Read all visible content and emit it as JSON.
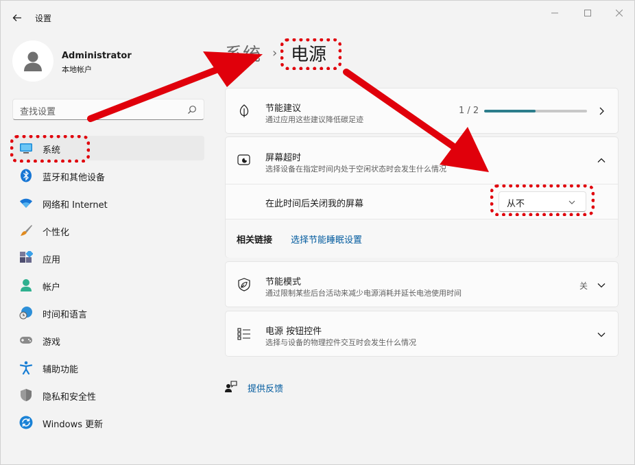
{
  "window": {
    "app_title": "设置"
  },
  "user": {
    "name": "Administrator",
    "subtitle": "本地帐户"
  },
  "search": {
    "placeholder": "查找设置"
  },
  "sidebar": {
    "items": [
      {
        "label": "系统",
        "icon": "monitor-icon",
        "active": true
      },
      {
        "label": "蓝牙和其他设备",
        "icon": "bluetooth-icon",
        "active": false
      },
      {
        "label": "网络和 Internet",
        "icon": "wifi-icon",
        "active": false
      },
      {
        "label": "个性化",
        "icon": "brush-icon",
        "active": false
      },
      {
        "label": "应用",
        "icon": "apps-icon",
        "active": false
      },
      {
        "label": "帐户",
        "icon": "account-icon",
        "active": false
      },
      {
        "label": "时间和语言",
        "icon": "globe-clock-icon",
        "active": false
      },
      {
        "label": "游戏",
        "icon": "gamepad-icon",
        "active": false
      },
      {
        "label": "辅助功能",
        "icon": "accessibility-icon",
        "active": false
      },
      {
        "label": "隐私和安全性",
        "icon": "shield-icon",
        "active": false
      },
      {
        "label": "Windows 更新",
        "icon": "sync-icon",
        "active": false
      }
    ]
  },
  "breadcrumb": {
    "parent": "系统",
    "separator": "›",
    "current": "电源"
  },
  "cards": {
    "energy": {
      "title": "节能建议",
      "desc": "通过应用这些建议降低碳足迹",
      "progress_text": "1 / 2",
      "progress_fraction": 0.5
    },
    "screen": {
      "title": "屏幕超时",
      "desc": "选择设备在指定时间内处于空闲状态时会发生什么情况",
      "sub_label": "在此时间后关闭我的屏幕",
      "dropdown_value": "从不",
      "related_title": "相关链接",
      "related_link": "选择节能睡眠设置"
    },
    "saver": {
      "title": "节能模式",
      "desc": "通过限制某些后台活动来减少电源消耗并延长电池使用时间",
      "state": "关"
    },
    "buttons": {
      "title": "电源 按钮控件",
      "desc": "选择与设备的物理控件交互时会发生什么情况"
    }
  },
  "feedback": {
    "label": "提供反馈"
  },
  "colors": {
    "annotation": "#e0000b",
    "accent": "#2c7d8c",
    "link": "#005a9e"
  }
}
